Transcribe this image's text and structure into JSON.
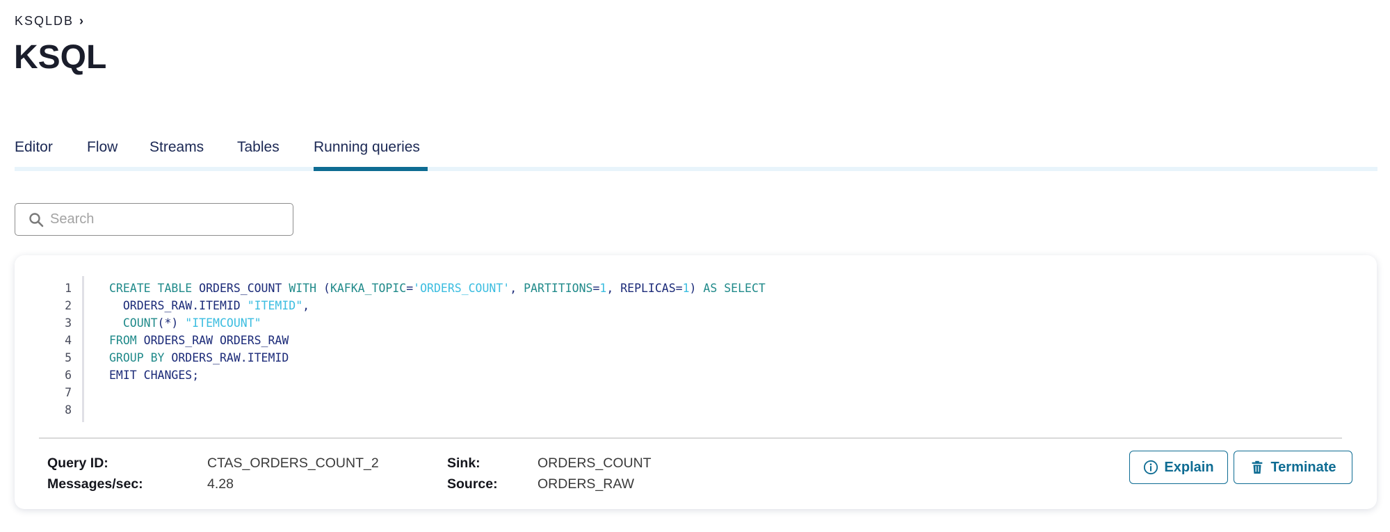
{
  "breadcrumb": {
    "parent": "KSQLDB",
    "separator_icon": "chevron-right-icon"
  },
  "page": {
    "title": "KSQL"
  },
  "tabs": [
    {
      "label": "Editor",
      "active": false
    },
    {
      "label": "Flow",
      "active": false
    },
    {
      "label": "Streams",
      "active": false
    },
    {
      "label": "Tables",
      "active": false
    },
    {
      "label": "Running queries",
      "active": true
    }
  ],
  "search": {
    "placeholder": "Search",
    "value": "",
    "icon": "search-icon"
  },
  "query_card": {
    "line_numbers": [
      "1",
      "2",
      "3",
      "4",
      "5",
      "6",
      "7",
      "8"
    ],
    "code_lines": [
      [
        {
          "t": "CREATE TABLE",
          "c": "kw"
        },
        {
          "t": " ",
          "c": "id"
        },
        {
          "t": "ORDERS_COUNT",
          "c": "id"
        },
        {
          "t": " ",
          "c": "id"
        },
        {
          "t": "WITH",
          "c": "kw"
        },
        {
          "t": " (",
          "c": "id"
        },
        {
          "t": "KAFKA_TOPIC",
          "c": "kw"
        },
        {
          "t": "=",
          "c": "id"
        },
        {
          "t": "'ORDERS_COUNT'",
          "c": "str"
        },
        {
          "t": ", ",
          "c": "id"
        },
        {
          "t": "PARTITIONS",
          "c": "kw"
        },
        {
          "t": "=",
          "c": "id"
        },
        {
          "t": "1",
          "c": "num"
        },
        {
          "t": ", REPLICAS=",
          "c": "id"
        },
        {
          "t": "1",
          "c": "num"
        },
        {
          "t": ") ",
          "c": "id"
        },
        {
          "t": "AS SELECT",
          "c": "kw"
        }
      ],
      [
        {
          "t": "  ORDERS_RAW.ITEMID ",
          "c": "id"
        },
        {
          "t": "\"ITEMID\"",
          "c": "str"
        },
        {
          "t": ",",
          "c": "id"
        }
      ],
      [
        {
          "t": "  ",
          "c": "id"
        },
        {
          "t": "COUNT",
          "c": "kw"
        },
        {
          "t": "(*) ",
          "c": "id"
        },
        {
          "t": "\"ITEMCOUNT\"",
          "c": "str"
        }
      ],
      [
        {
          "t": "FROM",
          "c": "kw"
        },
        {
          "t": " ORDERS_RAW ORDERS_RAW",
          "c": "id"
        }
      ],
      [
        {
          "t": "GROUP BY",
          "c": "kw"
        },
        {
          "t": " ORDERS_RAW.ITEMID",
          "c": "id"
        }
      ],
      [
        {
          "t": "EMIT CHANGES;",
          "c": "id"
        }
      ],
      [],
      []
    ],
    "details": {
      "query_id_label": "Query ID:",
      "query_id": "CTAS_ORDERS_COUNT_2",
      "messages_label": "Messages/sec:",
      "messages_per_sec": "4.28",
      "sink_label": "Sink:",
      "sink": "ORDERS_COUNT",
      "source_label": "Source:",
      "source": "ORDERS_RAW"
    },
    "actions": {
      "explain_label": "Explain",
      "explain_icon": "info-circle-icon",
      "terminate_label": "Terminate",
      "terminate_icon": "trash-icon"
    }
  },
  "colors": {
    "accent": "#0e6c93",
    "tab_track": "#e8f4fb",
    "keyword": "#208a8a",
    "identifier": "#1b2a78",
    "string_literal": "#3bbde0",
    "title_text": "#1a1d2b"
  }
}
